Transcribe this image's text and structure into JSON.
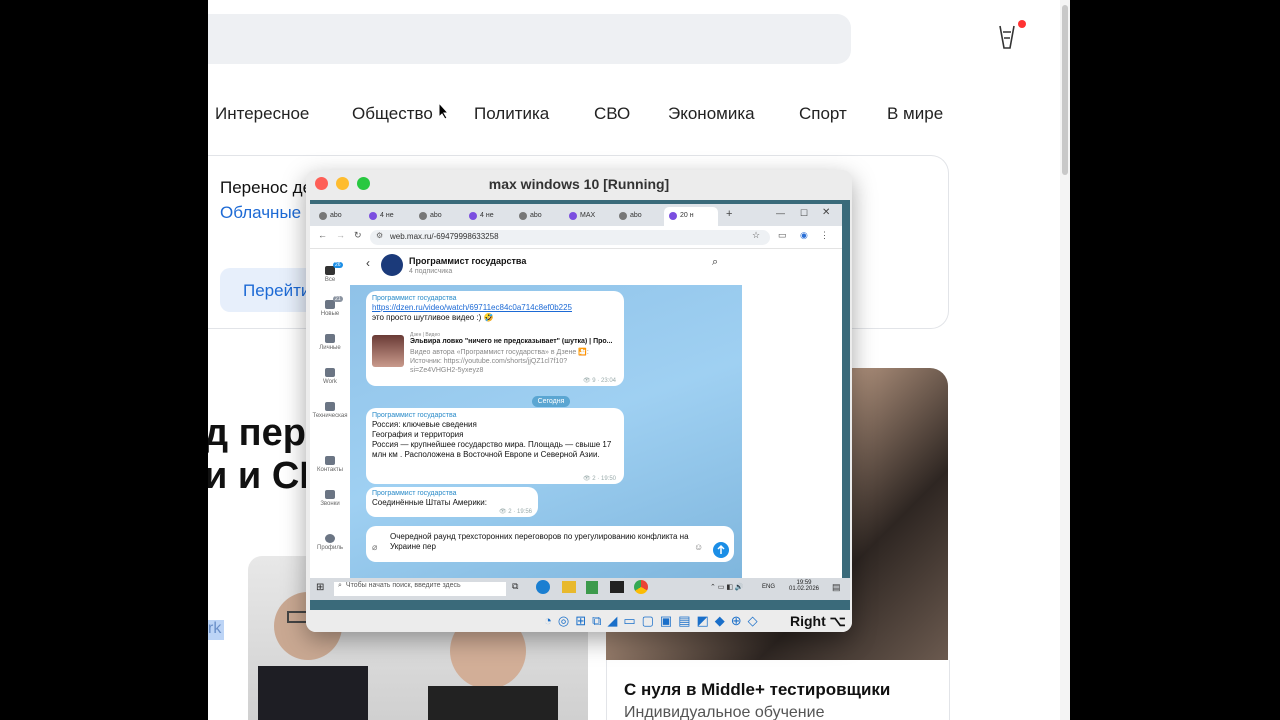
{
  "page": {
    "nav": [
      "Интересное",
      "Общество",
      "Политика",
      "СВО",
      "Экономика",
      "Спорт",
      "В мире"
    ],
    "promo": {
      "title": "Перенос де",
      "subtitle": "Облачные с",
      "button": "Перейти"
    },
    "headline": {
      "line1": "д пер",
      "line2": "и и СШ"
    },
    "selected_text": "rk",
    "right_card": {
      "title": "С нуля в Middle+ тестировщики",
      "subtitle": "Индивидуальное обучение"
    }
  },
  "vm": {
    "title": "max windows 10 [Running]",
    "host_key": "Right ⌥"
  },
  "browser": {
    "tabs": [
      "abo",
      "4 не",
      "abo",
      "4 не",
      "abo",
      "MAX",
      "abo",
      "20 н"
    ],
    "new_tab": "+",
    "url": "web.max.ru/-69479998633258"
  },
  "app": {
    "sidebar": [
      {
        "label": "Все",
        "badge": "26"
      },
      {
        "label": "Новые",
        "badge": "21"
      },
      {
        "label": "Личные",
        "badge": ""
      },
      {
        "label": "Work",
        "badge": ""
      },
      {
        "label": "Техническая",
        "badge": ""
      },
      {
        "label": "Контакты",
        "badge": ""
      },
      {
        "label": "Звонки",
        "badge": ""
      },
      {
        "label": "Профиль",
        "badge": ""
      }
    ],
    "chat": {
      "title": "Программист государства",
      "subscribers": "4 подписчика",
      "date_divider": "Сегодня",
      "messages": [
        {
          "author": "Программист государства",
          "link": "https://dzen.ru/video/watch/69711ec84c0a714c8ef0b225",
          "text": "это просто шутливое видео :) 🤣",
          "preview_source": "Дзен | Видео",
          "preview_title": "Эльвира ловко \"ничего не предсказывает\" (шутка) | Про...",
          "preview_desc": "Видео автора «Программист государства» в Дзене 🎦: Источник: https://youtube.com/shorts/jjQZ1cl7f10?si=Ze4VHGH2-5yxeyz8",
          "views": "9",
          "time": "23:04"
        },
        {
          "author": "Программист государства",
          "text_lines": [
            "Россия: ключевые сведения",
            "География и территория",
            "Россия — крупнейшее государство мира. Площадь — свыше 17 млн км . Расположена в Восточной Европе и Северной Азии."
          ],
          "views": "2",
          "time": "19:50"
        },
        {
          "author": "Программист государства",
          "text": "Соединённые Штаты Америки:",
          "views": "2",
          "time": "19:56"
        }
      ],
      "composer_text": "Очередной раунд трехсторонних переговоров по урегулированию конфликта на Украине пер"
    }
  },
  "taskbar": {
    "search_placeholder": "Чтобы начать поиск, введите здесь",
    "lang": "ENG",
    "time": "19:59",
    "date": "01.02.2026"
  }
}
